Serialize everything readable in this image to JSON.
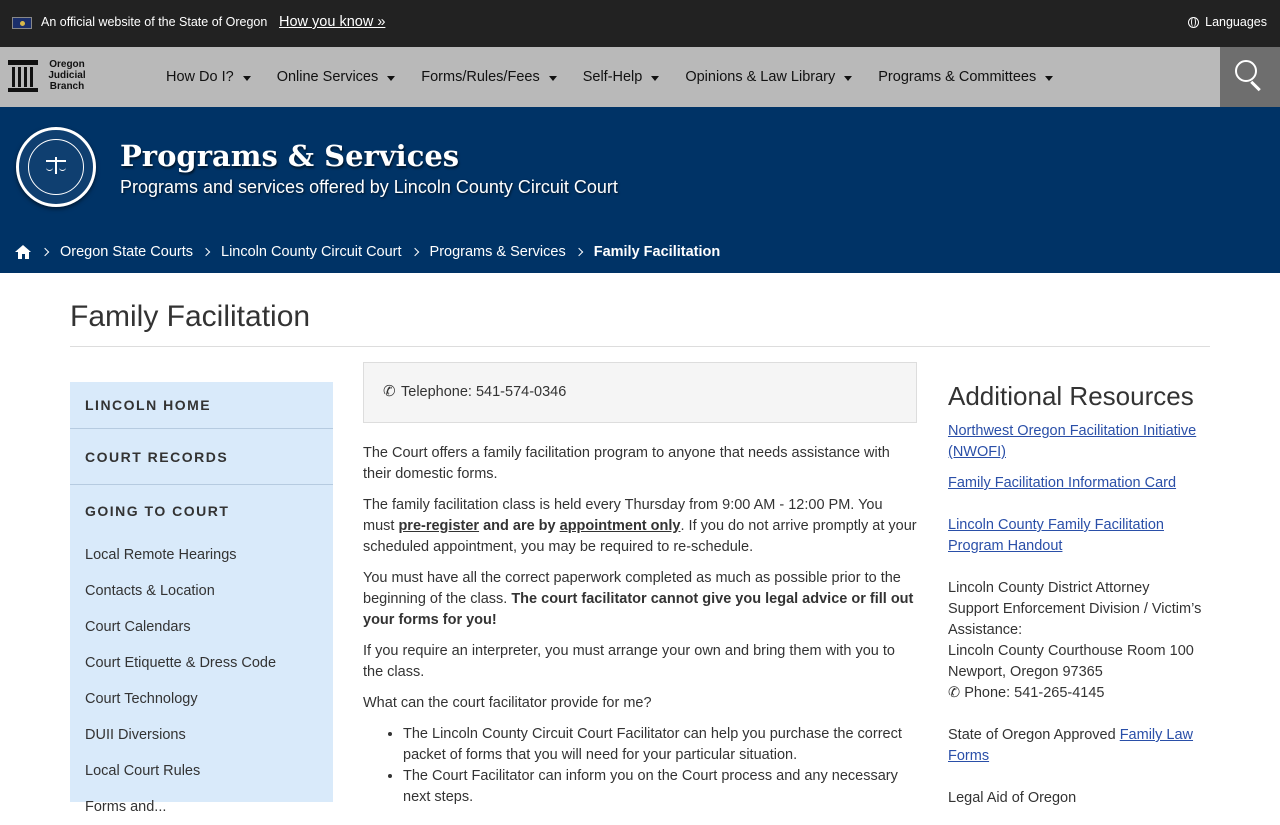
{
  "gov_bar": {
    "official_text": "An official website of the State of Oregon",
    "how_you_know": "How you know »",
    "languages": "Languages"
  },
  "logo": {
    "line1": "Oregon",
    "line2": "Judicial",
    "line3": "Branch"
  },
  "nav": {
    "items": [
      {
        "label": "How Do I?"
      },
      {
        "label": "Online Services"
      },
      {
        "label": "Forms/Rules/Fees"
      },
      {
        "label": "Self-Help"
      },
      {
        "label": "Opinions & Law Library"
      },
      {
        "label": "Programs & Committees"
      }
    ]
  },
  "banner": {
    "title": "Programs & Services",
    "subtitle": "Programs and services offered by Lincoln County Circuit Court"
  },
  "breadcrumbs": [
    "Oregon State Courts",
    "Lincoln County Circuit Court",
    "Programs & Services",
    "Family Facilitation"
  ],
  "page_title": "Family Facilitation",
  "sidebar": {
    "lincoln_home": "LINCOLN HOME",
    "court_records": "COURT RECORDS",
    "going_to_court": "GOING TO COURT",
    "links": [
      "Local Remote Hearings",
      "Contacts & Location",
      "Court Calendars",
      "Court Etiquette & Dress Code",
      "Court Technology",
      "DUII Diversions",
      "Local Court Rules",
      "Forms and..."
    ]
  },
  "phone_box": {
    "text": "Telephone: 541-574-0346"
  },
  "main": {
    "p1": "The Court offers a family facilitation program to anyone that needs assistance with their domestic forms.",
    "p2_a": "The family facilitation class is held every Thursday from 9:00 AM - 12:00 PM.  You must ",
    "p2_preregister": "pre-register",
    "p2_b": " and are by ",
    "p2_appointment": "appointment only",
    "p2_c": ". If you do not arrive promptly at your scheduled appointment, you may be required to re-schedule.",
    "p3_a": "You must have all the correct paperwork completed as much as possible prior to the beginning of the class.  ",
    "p3_bold": "The court facilitator cannot give you legal advice or fill out your forms for you!",
    "p4": "If you require an interpreter, you must arrange your own and bring them with you to the class.",
    "p5": "What can the court facilitator provide for me?",
    "bullets": [
      "The Lincoln County Circuit Court Facilitator can help you purchase the correct packet of forms that you will need for your particular situation.",
      "The Court Facilitator can inform you on the Court process and any necessary next steps."
    ]
  },
  "aside": {
    "heading": "Additional Resources",
    "link_nwofi": "Northwest Oregon Facilitation Initiative (NWOFI)",
    "link_card": "Family Facilitation Information Card",
    "link_handout": "Lincoln County Family Facilitation Program Handout",
    "da_line1": "Lincoln County District Attorney",
    "da_line2": "Support Enforcement Division / Victim’s Assistance:",
    "da_line3": "Lincoln County Courthouse Room 100",
    "da_line4": "Newport, Oregon 97365",
    "da_phone": "Phone: 541-265-4145",
    "approved_text": "State of Oregon Approved ",
    "approved_link": "Family Law Forms",
    "legal_aid": "Legal Aid of Oregon"
  }
}
